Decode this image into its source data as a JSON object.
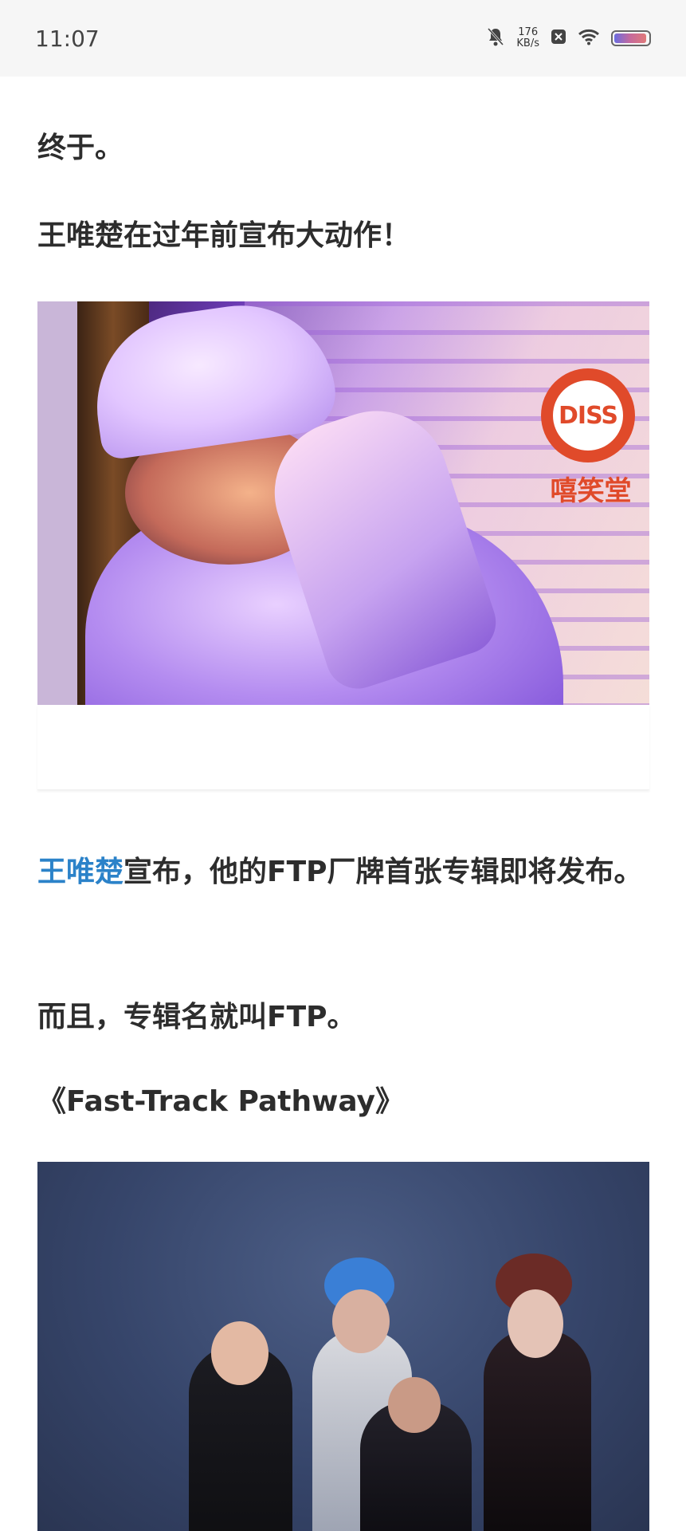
{
  "status_bar": {
    "time": "11:07",
    "net_speed_value": "176",
    "net_speed_unit": "KB/s",
    "icons": [
      "mute-bell-icon",
      "close-box-icon",
      "wifi-icon",
      "battery-icon"
    ]
  },
  "article": {
    "paragraphs": {
      "p1": "终于。",
      "p2": "王唯楚在过年前宣布大动作！",
      "p3_link": "王唯楚",
      "p3_rest": "宣布，他的FTP厂牌首张专辑即将发布。",
      "p4": "而且，专辑名就叫FTP。",
      "p5": "《Fast-Track Pathway》"
    },
    "image1": {
      "logo_text": "DISS",
      "brand_text": "嘻笑堂"
    }
  },
  "colors": {
    "link": "#2b82c9",
    "brand_red": "#e04a2a"
  }
}
